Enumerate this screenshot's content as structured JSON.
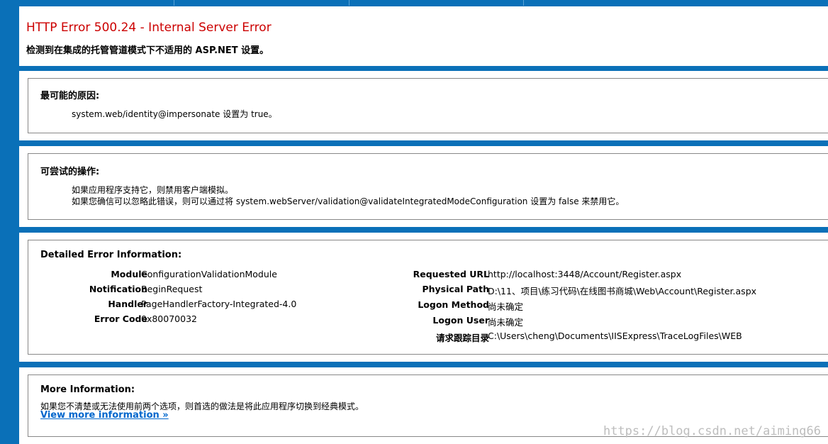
{
  "header": {
    "title": "HTTP Error 500.24 - Internal Server Error",
    "subtitle": "检测到在集成的托管管道模式下不适用的 ASP.NET 设置。"
  },
  "causes": {
    "title": "最可能的原因:",
    "lines": [
      "system.web/identity@impersonate 设置为 true。"
    ]
  },
  "actions": {
    "title": "可尝试的操作:",
    "lines": [
      "如果应用程序支持它，则禁用客户端模拟。",
      "如果您确信可以忽略此错误，则可以通过将 system.webServer/validation@validateIntegratedModeConfiguration 设置为 false 来禁用它。"
    ]
  },
  "details": {
    "title": "Detailed Error Information:",
    "left": [
      {
        "label": "Module",
        "value": "ConfigurationValidationModule"
      },
      {
        "label": "Notification",
        "value": "BeginRequest"
      },
      {
        "label": "Handler",
        "value": "PageHandlerFactory-Integrated-4.0"
      },
      {
        "label": "Error Code",
        "value": "0x80070032"
      }
    ],
    "right": [
      {
        "label": "Requested URL",
        "value": "http://localhost:3448/Account/Register.aspx"
      },
      {
        "label": "Physical Path",
        "value": "D:\\11、项目\\练习代码\\在线图书商城\\Web\\Account\\Register.aspx"
      },
      {
        "label": "Logon Method",
        "value": "尚未确定"
      },
      {
        "label": "Logon User",
        "value": "尚未确定"
      },
      {
        "label": "请求跟踪目录",
        "value": "C:\\Users\\cheng\\Documents\\IISExpress\\TraceLogFiles\\WEB"
      }
    ]
  },
  "more": {
    "title": "More Information:",
    "text": "如果您不清楚或无法使用前两个选项，则首选的做法是将此应用程序切换到经典模式。",
    "link": "View more information »"
  },
  "watermark": "https://blog.csdn.net/aiming66",
  "colors": {
    "frame": "#0a70b8",
    "error_title": "#cc0000",
    "link": "#0066cc"
  }
}
